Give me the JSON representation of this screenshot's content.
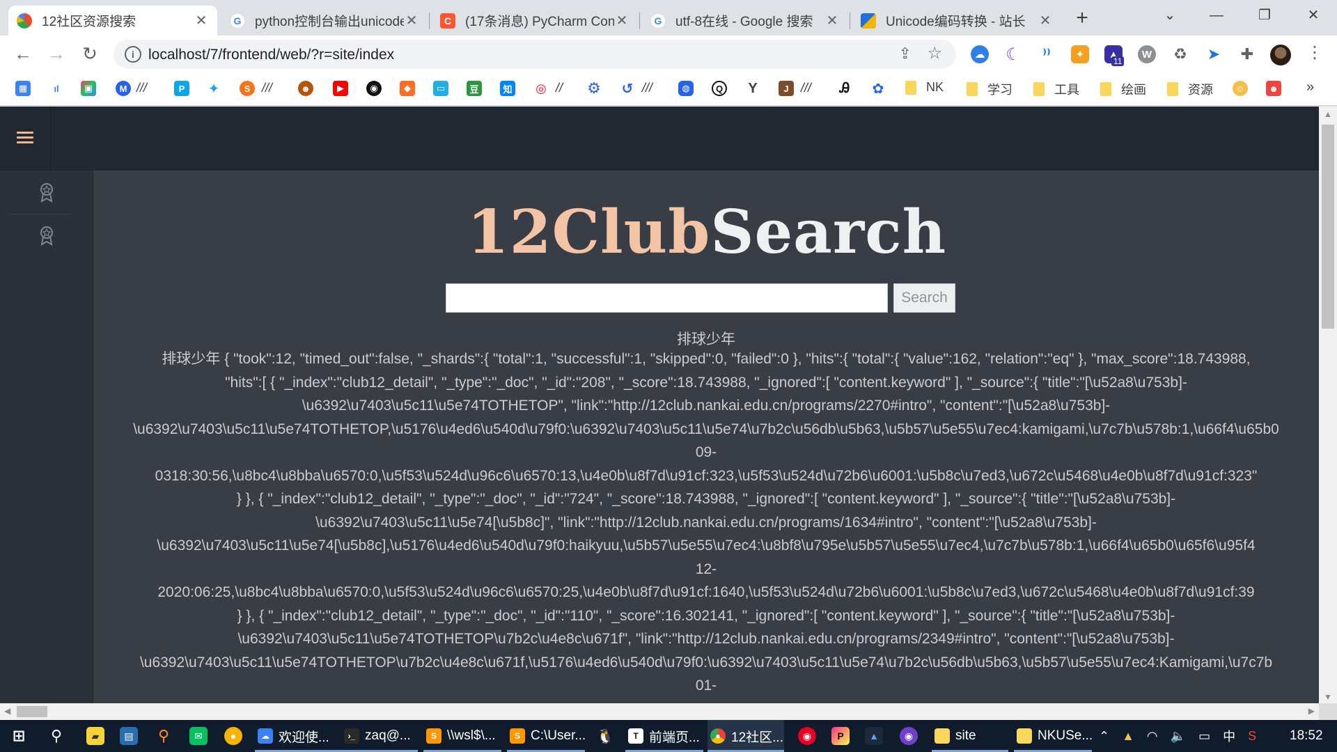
{
  "browser": {
    "tabs": [
      {
        "title": "12社区资源搜索",
        "active": true,
        "icon": "chrome-pie-icon",
        "color": "#e44d26"
      },
      {
        "title": "python控制台输出unicode",
        "active": false,
        "icon": "google-g-icon",
        "color": "#4285f4"
      },
      {
        "title": "(17条消息) PyCharm Con",
        "active": false,
        "icon": "csdn-c-icon",
        "color": "#fc5531"
      },
      {
        "title": "utf-8在线 - Google 搜索",
        "active": false,
        "icon": "google-g-icon",
        "color": "#4285f4"
      },
      {
        "title": "Unicode编码转换 - 站长",
        "active": false,
        "icon": "chinaz-icon",
        "color": "#1e6fd9"
      }
    ],
    "tab_close": "✕",
    "new_tab": "+",
    "window_controls": {
      "chevron": "⌄",
      "minimize": "—",
      "restore": "❐",
      "close": "✕"
    },
    "url": "localhost/7/frontend/web/?r=site/index",
    "bookmarks": {
      "separators": [
        "///",
        "///",
        "//",
        "///",
        "///"
      ],
      "folders": [
        "NK",
        "学习",
        "工具",
        "绘画",
        "资源"
      ],
      "more": "»"
    },
    "extensions_badge": "11"
  },
  "page": {
    "logo_part1": "12Club",
    "logo_part2": "Search",
    "search": {
      "value": "",
      "placeholder": "",
      "button_label": "Search"
    },
    "query_echo": "排球少年",
    "result_lines": [
      "排球少年 { \"took\":12, \"timed_out\":false, \"_shards\":{ \"total\":1, \"successful\":1, \"skipped\":0, \"failed\":0 }, \"hits\":{ \"total\":{ \"value\":162, \"relation\":\"eq\" }, \"max_score\":18.743988,",
      "\"hits\":[ { \"_index\":\"club12_detail\", \"_type\":\"_doc\", \"_id\":\"208\", \"_score\":18.743988, \"_ignored\":[ \"content.keyword\" ], \"_source\":{ \"title\":\"[\\u52a8\\u753b]-",
      "\\u6392\\u7403\\u5c11\\u5e74TOTHETOP\", \"link\":\"http://12club.nankai.edu.cn/programs/2270#intro\", \"content\":\"[\\u52a8\\u753b]-",
      "\\u6392\\u7403\\u5c11\\u5e74TOTHETOP,\\u5176\\u4ed6\\u540d\\u79f0:\\u6392\\u7403\\u5c11\\u5e74\\u7b2c\\u56db\\u5b63,\\u5b57\\u5e55\\u7ec4:kamigami,\\u7c7b\\u578b:1,\\u66f4\\u65b0",
      "09-",
      "0318:30:56,\\u8bc4\\u8bba\\u6570:0,\\u5f53\\u524d\\u96c6\\u6570:13,\\u4e0b\\u8f7d\\u91cf:323,\\u5f53\\u524d\\u72b6\\u6001:\\u5b8c\\u7ed3,\\u672c\\u5468\\u4e0b\\u8f7d\\u91cf:323\"",
      "} }, { \"_index\":\"club12_detail\", \"_type\":\"_doc\", \"_id\":\"724\", \"_score\":18.743988, \"_ignored\":[ \"content.keyword\" ], \"_source\":{ \"title\":\"[\\u52a8\\u753b]-",
      "\\u6392\\u7403\\u5c11\\u5e74[\\u5b8c]\", \"link\":\"http://12club.nankai.edu.cn/programs/1634#intro\", \"content\":\"[\\u52a8\\u753b]-",
      "\\u6392\\u7403\\u5c11\\u5e74[\\u5b8c],\\u5176\\u4ed6\\u540d\\u79f0:haikyuu,\\u5b57\\u5e55\\u7ec4:\\u8bf8\\u795e\\u5b57\\u5e55\\u7ec4,\\u7c7b\\u578b:1,\\u66f4\\u65b0\\u65f6\\u95f4",
      "12-",
      "2020:06:25,\\u8bc4\\u8bba\\u6570:0,\\u5f53\\u524d\\u96c6\\u6570:25,\\u4e0b\\u8f7d\\u91cf:1640,\\u5f53\\u524d\\u72b6\\u6001:\\u5b8c\\u7ed3,\\u672c\\u5468\\u4e0b\\u8f7d\\u91cf:39",
      "} }, { \"_index\":\"club12_detail\", \"_type\":\"_doc\", \"_id\":\"110\", \"_score\":16.302141, \"_ignored\":[ \"content.keyword\" ], \"_source\":{ \"title\":\"[\\u52a8\\u753b]-",
      "\\u6392\\u7403\\u5c11\\u5e74TOTHETOP\\u7b2c\\u4e8c\\u671f\", \"link\":\"http://12club.nankai.edu.cn/programs/2349#intro\", \"content\":\"[\\u52a8\\u753b]-",
      "\\u6392\\u7403\\u5c11\\u5e74TOTHETOP\\u7b2c\\u4e8c\\u671f,\\u5176\\u4ed6\\u540d\\u79f0:\\u6392\\u7403\\u5c11\\u5e74\\u7b2c\\u56db\\u5b63,\\u5b57\\u5e55\\u7ec4:Kamigami,\\u7c7b",
      "01-"
    ]
  },
  "taskbar": {
    "apps": [
      {
        "label": "欢迎使...",
        "icon": "cloud-app-icon",
        "color": "#3b82f6"
      },
      {
        "label": "zaq@...",
        "icon": "terminal-icon",
        "color": "#2a2a2a"
      },
      {
        "label": "\\\\wsl$\\...",
        "icon": "sublime-icon",
        "color": "#ff9800"
      },
      {
        "label": "C:\\User...",
        "icon": "sublime-icon",
        "color": "#ff9800"
      },
      {
        "label": "前端页...",
        "icon": "typora-icon",
        "color": "#ffffff"
      },
      {
        "label": "12社区...",
        "icon": "chrome-icon",
        "color": "#4285f4"
      },
      {
        "label": "site",
        "icon": "folder-icon",
        "color": "#f9d65c"
      },
      {
        "label": "NKUSe...",
        "icon": "folder-icon",
        "color": "#f9d65c"
      }
    ],
    "ime": "中",
    "time": "18:52"
  }
}
